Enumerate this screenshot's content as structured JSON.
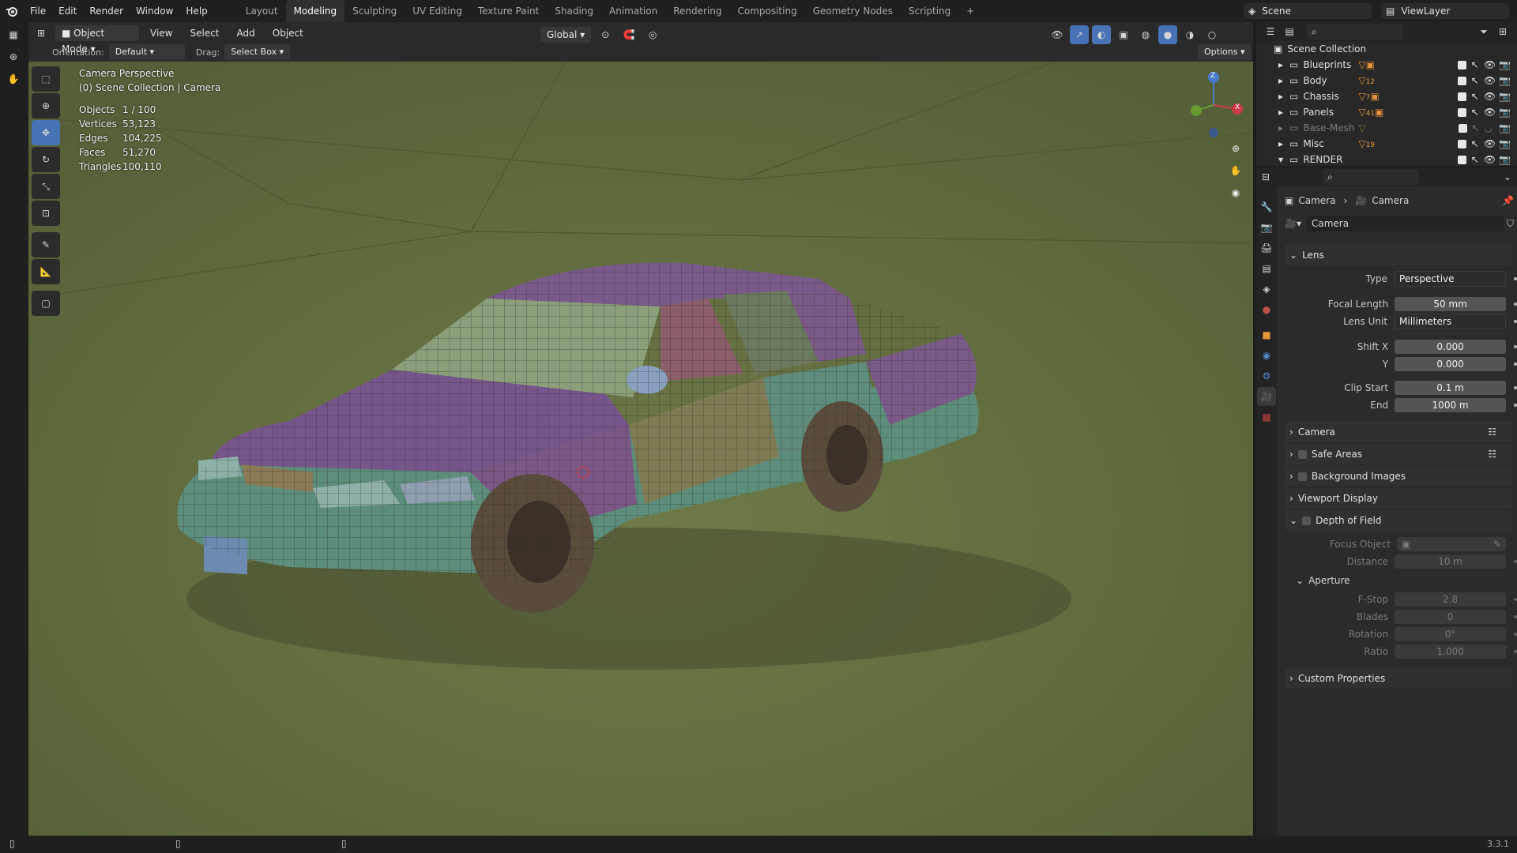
{
  "menu": [
    "File",
    "Edit",
    "Render",
    "Window",
    "Help"
  ],
  "workspaces": [
    "Layout",
    "Modeling",
    "Sculpting",
    "UV Editing",
    "Texture Paint",
    "Shading",
    "Animation",
    "Rendering",
    "Compositing",
    "Geometry Nodes",
    "Scripting"
  ],
  "active_workspace": "Modeling",
  "scene_name": "Scene",
  "view_layer": "ViewLayer",
  "viewport_header": {
    "mode": "Object Mode",
    "menus": [
      "View",
      "Select",
      "Add",
      "Object"
    ],
    "transform_orientation": "Global",
    "orientation_label": "Orientation:",
    "orientation_value": "Default",
    "drag_label": "Drag:",
    "drag_value": "Select Box",
    "options_label": "Options"
  },
  "overlay": {
    "view_name": "Camera Perspective",
    "collection": "(0) Scene Collection | Camera",
    "stats": [
      {
        "label": "Objects",
        "value": "1 / 100"
      },
      {
        "label": "Vertices",
        "value": "53,123"
      },
      {
        "label": "Edges",
        "value": "104,225"
      },
      {
        "label": "Faces",
        "value": "51,270"
      },
      {
        "label": "Triangles",
        "value": "100,110"
      }
    ]
  },
  "gizmo": {
    "z": "Z",
    "x": "X"
  },
  "outliner": {
    "root": "Scene Collection",
    "collections": [
      {
        "name": "Blueprints",
        "count": "",
        "enabled": true
      },
      {
        "name": "Body",
        "count": "12",
        "enabled": true
      },
      {
        "name": "Chassis",
        "count": "7",
        "enabled": true
      },
      {
        "name": "Panels",
        "count": "41",
        "enabled": true
      },
      {
        "name": "Base-Mesh",
        "count": "",
        "enabled": false
      },
      {
        "name": "Misc",
        "count": "19",
        "enabled": true
      },
      {
        "name": "RENDER",
        "count": "",
        "enabled": true
      }
    ]
  },
  "properties": {
    "breadcrumb_object": "Camera",
    "breadcrumb_data": "Camera",
    "data_name": "Camera",
    "lens_panel": "Lens",
    "lens": {
      "type_label": "Type",
      "type_value": "Perspective",
      "focal_label": "Focal Length",
      "focal_value": "50 mm",
      "unit_label": "Lens Unit",
      "unit_value": "Millimeters",
      "shiftx_label": "Shift X",
      "shiftx_value": "0.000",
      "shifty_label": "Y",
      "shifty_value": "0.000",
      "clipstart_label": "Clip Start",
      "clipstart_value": "0.1 m",
      "clipend_label": "End",
      "clipend_value": "1000 m"
    },
    "panels": [
      "Camera",
      "Safe Areas",
      "Background Images",
      "Viewport Display",
      "Depth of Field"
    ],
    "dof": {
      "focus_label": "Focus Object",
      "distance_label": "Distance",
      "distance_value": "10 m",
      "aperture_panel": "Aperture",
      "fstop_label": "F-Stop",
      "fstop_value": "2.8",
      "blades_label": "Blades",
      "blades_value": "0",
      "rotation_label": "Rotation",
      "rotation_value": "0°",
      "ratio_label": "Ratio",
      "ratio_value": "1.000"
    },
    "custom_props": "Custom Properties"
  },
  "version": "3.3.1",
  "colors": {
    "accent": "#4772b3",
    "viewport_bg": "#7d8a52",
    "car_purple": "#7a5a82",
    "car_teal": "#5a8a78",
    "car_olive": "#7a7a55"
  }
}
